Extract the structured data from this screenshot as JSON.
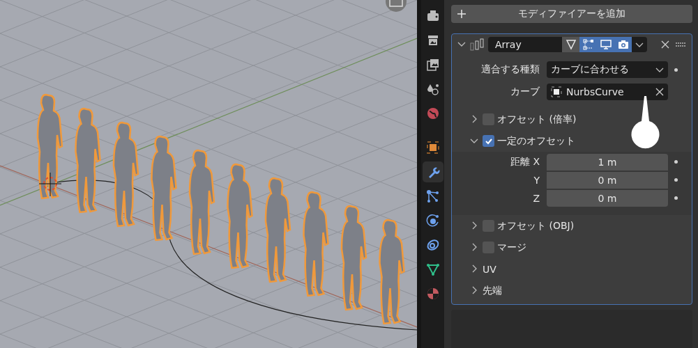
{
  "tabs": [
    {
      "kind": "render",
      "selected": false
    },
    {
      "kind": "output",
      "selected": false
    },
    {
      "kind": "view_layer",
      "selected": false
    },
    {
      "kind": "scene",
      "selected": false
    },
    {
      "kind": "world",
      "selected": false
    },
    {
      "kind": "object",
      "selected": false
    },
    {
      "kind": "modifiers",
      "selected": true
    },
    {
      "kind": "particles",
      "selected": false
    },
    {
      "kind": "physics",
      "selected": false
    },
    {
      "kind": "constraints",
      "selected": false
    },
    {
      "kind": "data",
      "selected": false
    },
    {
      "kind": "material",
      "selected": false
    }
  ],
  "add_modifier": {
    "label": "モディファイアーを追加"
  },
  "modifier": {
    "name": "Array",
    "expanded": true,
    "toggles": [
      {
        "kind": "on_cage",
        "on": false
      },
      {
        "kind": "edit_mode",
        "on": true
      },
      {
        "kind": "viewport",
        "on": true
      },
      {
        "kind": "render",
        "on": true
      }
    ],
    "fit_type": {
      "label": "適合する種類",
      "value": "カーブに合わせる"
    },
    "curve": {
      "label": "カーブ",
      "value": "NurbsCurve"
    },
    "sections": [
      {
        "kind": "checkbox",
        "label": "オフセット (倍率)",
        "checked": false,
        "expanded": false
      },
      {
        "kind": "checkbox",
        "label": "一定のオフセット",
        "checked": true,
        "expanded": true,
        "fields": [
          {
            "label": "距離 X",
            "value": "1 m"
          },
          {
            "label": "Y",
            "value": "0 m"
          },
          {
            "label": "Z",
            "value": "0 m"
          }
        ]
      },
      {
        "kind": "checkbox",
        "label": "オフセット (OBJ)",
        "checked": false,
        "expanded": false
      },
      {
        "kind": "checkbox",
        "label": "マージ",
        "checked": false,
        "expanded": false
      },
      {
        "kind": "plain",
        "label": "UV",
        "expanded": false
      },
      {
        "kind": "plain",
        "label": "先端",
        "expanded": false
      }
    ]
  }
}
